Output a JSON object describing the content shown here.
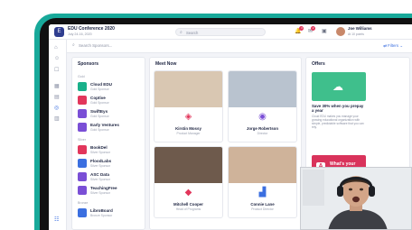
{
  "header": {
    "conference_title": "EDU Conference 2020",
    "conference_date": "July 24-16, 2020",
    "search_placeholder": "Search",
    "notification_count": "3",
    "message_count": "2",
    "user_name": "Joe Williams",
    "user_subtitle": "At 10 points"
  },
  "subbar": {
    "search_placeholder": "Search Sponsors...",
    "filters_label": "Filters"
  },
  "sponsors": {
    "title": "Sponsors",
    "groups": [
      {
        "label": "Gold",
        "items": [
          {
            "name": "Cloud EDU",
            "tier": "Gold Sponsor",
            "color": "#19b08a"
          },
          {
            "name": "Coptive",
            "tier": "Gold Sponsor",
            "color": "#e2365b"
          },
          {
            "name": "SwiftEys",
            "tier": "Gold Sponsor",
            "color": "#7a4fd6"
          },
          {
            "name": "Early Ventures",
            "tier": "Gold Sponsor",
            "color": "#7a4fd6"
          }
        ]
      },
      {
        "label": "Silver",
        "items": [
          {
            "name": "BookDel",
            "tier": "Silver Sponsor",
            "color": "#e2365b"
          },
          {
            "name": "FloodLabs",
            "tier": "Silver Sponsor",
            "color": "#3b6fe0"
          },
          {
            "name": "ASC Data",
            "tier": "Silver Sponsor",
            "color": "#7a4fd6"
          },
          {
            "name": "TeachingFree",
            "tier": "Silver Sponsor",
            "color": "#7a4fd6"
          }
        ]
      },
      {
        "label": "Bronze",
        "items": [
          {
            "name": "LibroBoard",
            "tier": "Bronze Sponsor",
            "color": "#3b6fe0"
          }
        ]
      }
    ]
  },
  "meet_now": {
    "title": "Meet Now",
    "people": [
      {
        "name": "Kirstin Mossy",
        "role": "Product Manager",
        "brand_color": "#e2365b",
        "photo": "#d9c7b2"
      },
      {
        "name": "Jorge Robertson",
        "role": "Director",
        "brand_color": "#7a4fd6",
        "photo": "#b9c3cf"
      },
      {
        "name": "Mitchell Cooper",
        "role": "Head of Programs",
        "brand_color": "#e2365b",
        "photo": "#6e5a4c"
      },
      {
        "name": "Connie Lane",
        "role": "Product Director",
        "brand_color": "#3b6fe0",
        "photo": "#cfb39a"
      }
    ]
  },
  "offers": {
    "title": "Offers",
    "offer1_headline": "Save 30% when you prepay a year",
    "offer1_body": "Cloud EDU makes you manage your growing educational organization with simple, predictable software that you can rely.",
    "offer2_text": "What's your data strategy?"
  },
  "colors": {
    "bezel": "#18a99a",
    "accent": "#3b6fe0"
  }
}
